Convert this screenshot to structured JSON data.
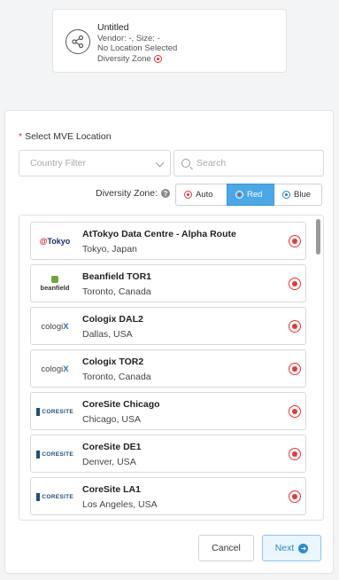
{
  "summary": {
    "title": "Untitled",
    "vendor_line": "Vendor: -, Size: -",
    "location_line": "No Location Selected",
    "diversity_line": "Diversity Zone"
  },
  "panel": {
    "required_mark": "*",
    "section_label": "Select MVE Location",
    "country_filter_placeholder": "Country Filter",
    "search_placeholder": "Search",
    "diversity_label": "Diversity Zone:",
    "help_glyph": "?",
    "zones": [
      {
        "label": "Auto",
        "selected": false
      },
      {
        "label": "Red",
        "selected": true
      },
      {
        "label": "Blue",
        "selected": false
      }
    ],
    "locations": [
      {
        "name": "AtTokyo Data Centre - Alpha Route",
        "city": "Tokyo, Japan",
        "logo": "@Tokyo"
      },
      {
        "name": "Beanfield TOR1",
        "city": "Toronto, Canada",
        "logo": "beanfield"
      },
      {
        "name": "Cologix DAL2",
        "city": "Dallas, USA",
        "logo": "cologix"
      },
      {
        "name": "Cologix TOR2",
        "city": "Toronto, Canada",
        "logo": "cologix"
      },
      {
        "name": "CoreSite Chicago",
        "city": "Chicago, USA",
        "logo": "CORESITE"
      },
      {
        "name": "CoreSite DE1",
        "city": "Denver, USA",
        "logo": "CORESITE"
      },
      {
        "name": "CoreSite LA1",
        "city": "Los Angeles, USA",
        "logo": "CORESITE"
      }
    ],
    "cancel_label": "Cancel",
    "next_label": "Next"
  },
  "colors": {
    "accent": "#4aa8e8",
    "diversity_red": "#e33333",
    "required": "#e0303a"
  }
}
